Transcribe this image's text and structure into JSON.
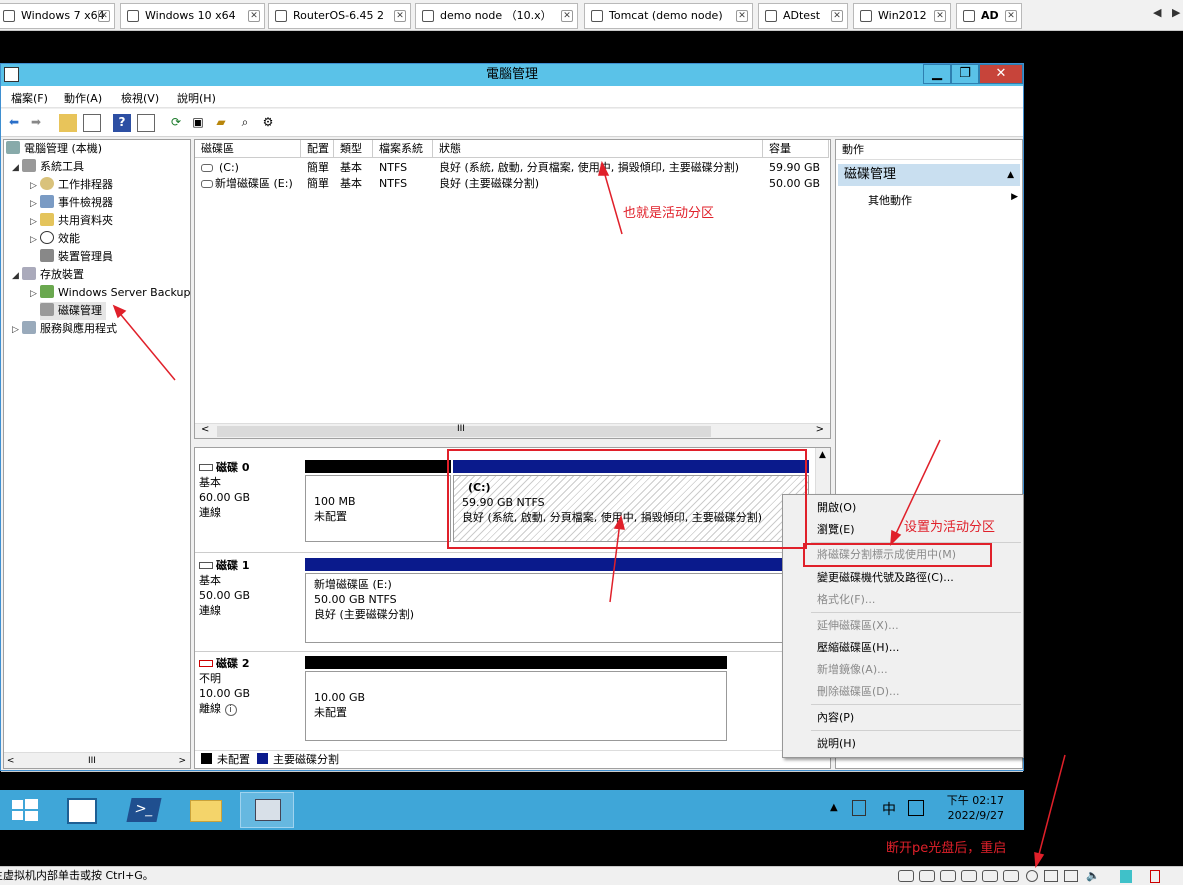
{
  "vm_tabs": [
    {
      "label": "Windows 7 x64"
    },
    {
      "label": "Windows 10 x64"
    },
    {
      "label": "RouterOS-6.45 2"
    },
    {
      "label": "demo node （10.x）"
    },
    {
      "label": "Tomcat (demo node)"
    },
    {
      "label": "ADtest"
    },
    {
      "label": "Win2012"
    },
    {
      "label": "AD"
    }
  ],
  "window": {
    "title": "電腦管理",
    "minimize": "▁",
    "restore": "❐",
    "close": "✕"
  },
  "menu": [
    "檔案(F)",
    "動作(A)",
    "檢視(V)",
    "說明(H)"
  ],
  "tree": [
    {
      "label": "電腦管理 (本機)"
    },
    {
      "label": "系統工具"
    },
    {
      "label": "工作排程器"
    },
    {
      "label": "事件檢視器"
    },
    {
      "label": "共用資料夾"
    },
    {
      "label": "效能"
    },
    {
      "label": "裝置管理員"
    },
    {
      "label": "存放裝置"
    },
    {
      "label": "Windows Server Backup"
    },
    {
      "label": "磁碟管理"
    },
    {
      "label": "服務與應用程式"
    }
  ],
  "list": {
    "headers": [
      "磁碟區",
      "配置",
      "類型",
      "檔案系統",
      "狀態",
      "容量"
    ],
    "rows": [
      [
        "(C:)",
        "簡單",
        "基本",
        "NTFS",
        "良好 (系統, 啟動, 分頁檔案, 使用中, 損毀傾印, 主要磁碟分割)",
        "59.90 GB"
      ],
      [
        "新增磁碟區 (E:)",
        "簡單",
        "基本",
        "NTFS",
        "良好 (主要磁碟分割)",
        "50.00 GB"
      ]
    ],
    "scroll_mark": "III"
  },
  "disks": [
    {
      "name": "磁碟 0",
      "type": "基本",
      "size": "60.00 GB",
      "state": "連線"
    },
    {
      "name": "磁碟 1",
      "type": "基本",
      "size": "50.00 GB",
      "state": "連線"
    },
    {
      "name": "磁碟 2",
      "type": "不明",
      "size": "10.00 GB",
      "state": "離線"
    }
  ],
  "partitions": {
    "d0_unalloc": {
      "size": "100 MB",
      "status": "未配置"
    },
    "d0_c": {
      "name": "(C:)",
      "size": "59.90 GB NTFS",
      "status": "良好 (系統, 啟動, 分頁檔案, 使用中, 損毀傾印, 主要磁碟分割)"
    },
    "d1_e": {
      "name": "新增磁碟區 (E:)",
      "size": "50.00 GB NTFS",
      "status": "良好 (主要磁碟分割)"
    },
    "d2_unalloc": {
      "size": "10.00 GB",
      "status": "未配置"
    }
  },
  "legend": {
    "unallocated": "未配置",
    "primary": "主要磁碟分割"
  },
  "actions": {
    "header": "動作",
    "section": "磁碟管理",
    "more": "其他動作"
  },
  "context_menu": [
    {
      "label": "開啟(O)",
      "enabled": true
    },
    {
      "label": "瀏覽(E)",
      "enabled": true
    },
    {
      "label": "將磁碟分割標示成使用中(M)",
      "enabled": false
    },
    {
      "label": "變更磁碟機代號及路徑(C)...",
      "enabled": true
    },
    {
      "label": "格式化(F)...",
      "enabled": false
    },
    {
      "label": "延伸磁碟區(X)...",
      "enabled": false
    },
    {
      "label": "壓縮磁碟區(H)...",
      "enabled": true
    },
    {
      "label": "新增鏡像(A)...",
      "enabled": false
    },
    {
      "label": "刪除磁碟區(D)...",
      "enabled": false
    },
    {
      "label": "內容(P)",
      "enabled": true
    },
    {
      "label": "說明(H)",
      "enabled": true
    }
  ],
  "taskbar": {
    "ime": "中",
    "time": "下午 02:17",
    "date": "2022/9/27"
  },
  "annotations": {
    "active_partition": "也就是活动分区",
    "set_active": "设置为活动分区",
    "eject": "断开pe光盘后，重启"
  },
  "statusbar": {
    "hint": "主虚拟机内部单击或按 Ctrl+G。"
  },
  "colors": {
    "title": "#5ac2e8",
    "taskbar": "#3fa6d8",
    "primary": "#0a1a8c",
    "annotation": "#e0202a"
  }
}
